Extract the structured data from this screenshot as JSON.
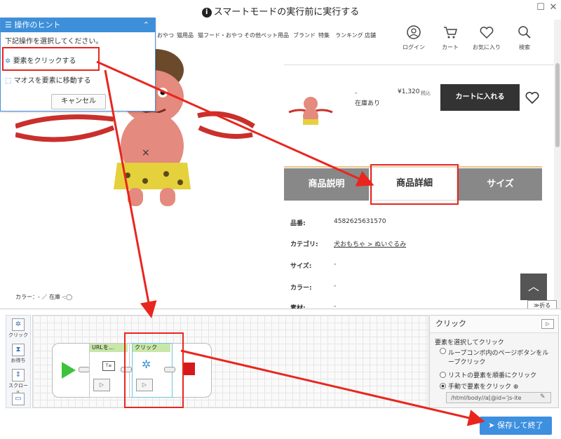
{
  "window": {
    "title": "スマートモードの実行前に実行する",
    "info_glyph": "i"
  },
  "site": {
    "nav": [
      "おやつ",
      "猫用品",
      "猫フード・おやつ",
      "その他ペット用品",
      "ブランド",
      "特集",
      "ランキング",
      "店舗"
    ],
    "header_icons": [
      {
        "name": "user-icon",
        "label": "ログイン"
      },
      {
        "name": "cart-icon",
        "label": "カート"
      },
      {
        "name": "heart-icon",
        "label": "お気に入り"
      },
      {
        "name": "search-icon",
        "label": "検索"
      }
    ],
    "product": {
      "dash": "-",
      "price": "¥1,320",
      "tax": "税込",
      "stock": "在庫あり",
      "add_to_cart": "カートに入れる",
      "color_stock_line": "カラー：- ／ 在庫 -:◯"
    },
    "tabs": [
      "商品説明",
      "商品詳細",
      "サイズ"
    ],
    "details": [
      {
        "key": "品番:",
        "value": "4582625631570"
      },
      {
        "key": "カテゴリ:",
        "value": "犬おもちゃ > ぬいぐるみ"
      },
      {
        "key": "サイズ:",
        "value": "-"
      },
      {
        "key": "カラー:",
        "value": "-"
      },
      {
        "key": "素材:",
        "value": "-"
      }
    ],
    "collapse_label": "折る"
  },
  "hint": {
    "title": "操作のヒント",
    "subtitle": "下記操作を選択してください。",
    "option_click": "要素をクリックする",
    "option_move": "マオスを要素に移動する",
    "cancel": "キャンセル"
  },
  "palette": [
    "クリック",
    "お待ち",
    "スクロール"
  ],
  "flow": {
    "node_url": "URLを...",
    "node_click": "クリック"
  },
  "props": {
    "title": "クリック",
    "section": "要素を選択してクリック",
    "options": [
      "ループコンボ内のページボタンをループクリック",
      "リストの要素を順番にクリック",
      "手動で要素をクリック"
    ],
    "selected": 2,
    "xpath": "/html/body//a[@id='js-ite"
  },
  "save_button": "保存して終了",
  "colors": {
    "accent": "#3d8fe0",
    "highlight": "#e8261e",
    "cart_button": "#333333"
  }
}
